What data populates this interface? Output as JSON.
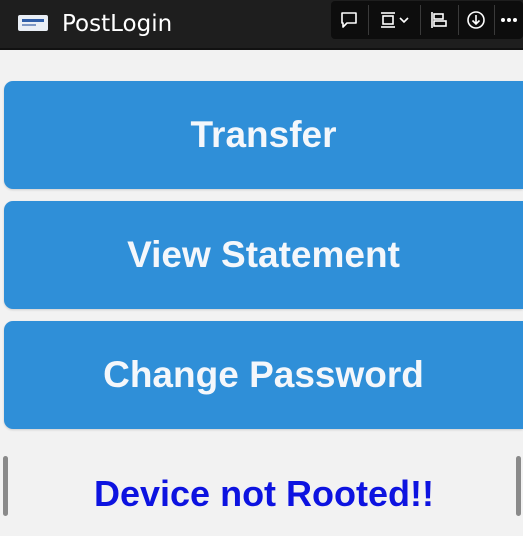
{
  "window": {
    "title": "PostLogin"
  },
  "toolbar": {
    "icons": [
      "comment-icon",
      "frame-icon",
      "chevron-down-icon",
      "align-icon",
      "download-icon",
      "more-icon"
    ]
  },
  "actions": [
    {
      "label": "Transfer"
    },
    {
      "label": "View Statement"
    },
    {
      "label": "Change Password"
    }
  ],
  "status": {
    "text": "Device not Rooted!!",
    "color": "#0d13e0"
  },
  "colors": {
    "titlebar": "#1e1e1e",
    "button": "#2f8fd8",
    "background": "#f2f2f2"
  }
}
